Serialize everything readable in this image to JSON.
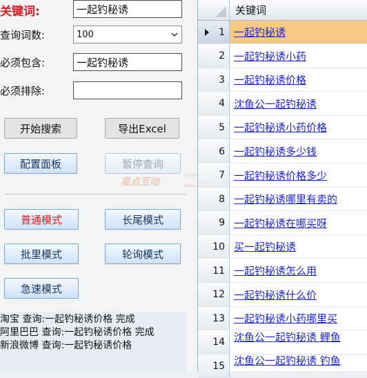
{
  "form": {
    "keyword_label": "关键词:",
    "keyword_value": "一起钓秘诱",
    "count_label": "查询词数:",
    "count_value": "100",
    "include_label": "必须包含:",
    "include_value": "一起钓秘诱",
    "exclude_label": "必须排除:",
    "exclude_value": ""
  },
  "buttons": {
    "start_search": "开始搜索",
    "export_excel": "导出Excel",
    "config_panel": "配置面板",
    "pause_query": "暂停查询",
    "normal_mode": "普通模式",
    "longtail_mode": "长尾模式",
    "batch_mode": "批里模式",
    "poll_mode": "轮询模式",
    "fast_mode": "急速模式"
  },
  "watermark": {
    "brand": "星点互动",
    "sub1": "xingdian.com",
    "sub2": "www.xingdian.com"
  },
  "log": {
    "lines": [
      "淘宝 查询:一起钓秘诱价格 完成",
      "阿里巴巴 查询:一起钓秘诱价格 完成",
      "新浪微博 查询:一起钓秘诱价格"
    ]
  },
  "table": {
    "header": "关键词",
    "rows": [
      {
        "num": "1",
        "keyword": "一起钓秘诱"
      },
      {
        "num": "2",
        "keyword": "一起钓秘诱小药"
      },
      {
        "num": "3",
        "keyword": "一起钓秘诱价格"
      },
      {
        "num": "4",
        "keyword": "沈鱼公一起钓秘诱"
      },
      {
        "num": "5",
        "keyword": "一起钓秘诱小药价格"
      },
      {
        "num": "6",
        "keyword": "一起钓秘诱多少钱"
      },
      {
        "num": "7",
        "keyword": "一起钓秘诱价格多少"
      },
      {
        "num": "8",
        "keyword": "一起钓秘诱哪里有卖的"
      },
      {
        "num": "9",
        "keyword": "一起钓秘诱在哪买呀"
      },
      {
        "num": "10",
        "keyword": "买一起钓秘诱"
      },
      {
        "num": "11",
        "keyword": "一起钓秘诱怎么用"
      },
      {
        "num": "12",
        "keyword": "一起钓秘诱什么价"
      },
      {
        "num": "13",
        "keyword": "一起钓秘诱小药哪里买"
      },
      {
        "num": "14",
        "keyword": "沈鱼公一起钓秘诱 鲤鱼"
      },
      {
        "num": "15",
        "keyword": "沈鱼公一起钓秘诱 钓鱼"
      }
    ]
  },
  "colors": {
    "label_red": "#e0191f",
    "link_blue": "#1d27c9",
    "selection": "#f7c982"
  }
}
